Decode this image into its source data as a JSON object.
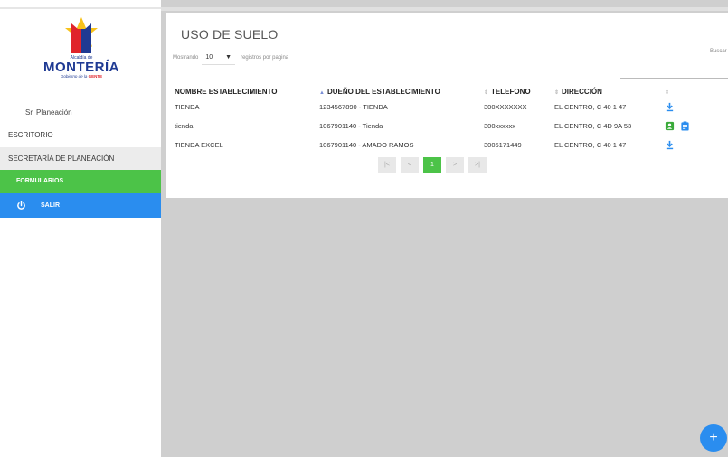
{
  "sidebar": {
    "logo": {
      "alcaldia": "Alcaldía de",
      "city": "MONTERÍA",
      "slogan_prefix": "Gobierno de la",
      "slogan_brand": "GENTE"
    },
    "user_name": "Sr. Planeación",
    "items": [
      {
        "label": "ESCRITORIO"
      },
      {
        "label": "SECRETARÍA DE PLANEACIÓN"
      },
      {
        "label": "FORMULARIOS"
      },
      {
        "label": "SALIR"
      }
    ]
  },
  "main": {
    "title": "USO DE SUELO",
    "show_prefix": "Mostrando",
    "entries_value": "10",
    "show_suffix": "registros por pagina",
    "search_label": "Buscar",
    "table": {
      "headers": [
        "NOMBRE ESTABLECIMIENTO",
        "DUEÑO DEL ESTABLECIMIENTO",
        "TELEFONO",
        "DIRECCIÓN"
      ],
      "rows": [
        {
          "nombre": "TIENDA",
          "dueno": "1234567890 - TIENDA",
          "telefono": "300XXXXXXX",
          "direccion": "EL CENTRO, C 40 1 47",
          "actions": [
            "download-icon"
          ]
        },
        {
          "nombre": "tienda",
          "dueno": "1067901140 - Tienda",
          "telefono": "300xxxxxx",
          "direccion": "EL CENTRO, C 4D 9A 53",
          "actions": [
            "user-badge-icon",
            "clipboard-icon"
          ]
        },
        {
          "nombre": "TIENDA EXCEL",
          "dueno": "1067901140 - AMADO RAMOS",
          "telefono": "3005171449",
          "direccion": "EL CENTRO, C 40 1 47",
          "actions": [
            "download-icon"
          ]
        }
      ]
    },
    "pagination": {
      "first": "|<",
      "prev": "<",
      "current": "1",
      "next": ">",
      "last": ">|"
    }
  },
  "fab": {
    "label": "+"
  },
  "colors": {
    "green": "#4cc348",
    "blue": "#2a8def",
    "navy": "#1f3a93",
    "icon_green": "#3aaa3a"
  }
}
